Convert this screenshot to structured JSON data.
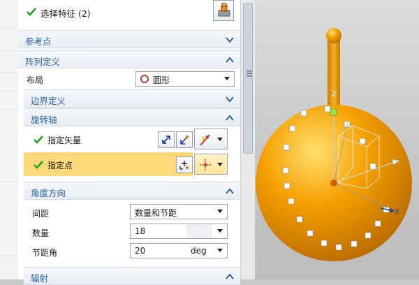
{
  "feature_select": {
    "label": "选择特征 (2)"
  },
  "sections": {
    "reference_point": "参考点",
    "pattern_definition": "阵列定义",
    "boundary_definition": "边界定义",
    "rotation_axis": "旋转轴",
    "angle_direction": "角度方向",
    "radiation": "辐射"
  },
  "layout": {
    "label": "布局",
    "value": "圆形"
  },
  "rotation_axis": {
    "specify_vector": "指定矢量",
    "specify_point": "指定点"
  },
  "angle_direction": {
    "spacing_label": "间距",
    "spacing_value": "数量和节距",
    "count_label": "数量",
    "count_value": "18",
    "pitch_label": "节距角",
    "pitch_value": "20",
    "pitch_unit": "deg"
  },
  "viewport": {
    "axis_z": "Z",
    "axis_x": "X"
  },
  "colors": {
    "accent_blue": "#2a64a6",
    "highlight": "#fdd97a",
    "model_orange": "#f5a000",
    "check_green": "#22a022"
  },
  "icons": [
    "check-icon",
    "chevron-down-icon",
    "chevron-up-icon",
    "circle-layout-icon",
    "vector-icon",
    "point-icon",
    "solid-feature-icon"
  ]
}
